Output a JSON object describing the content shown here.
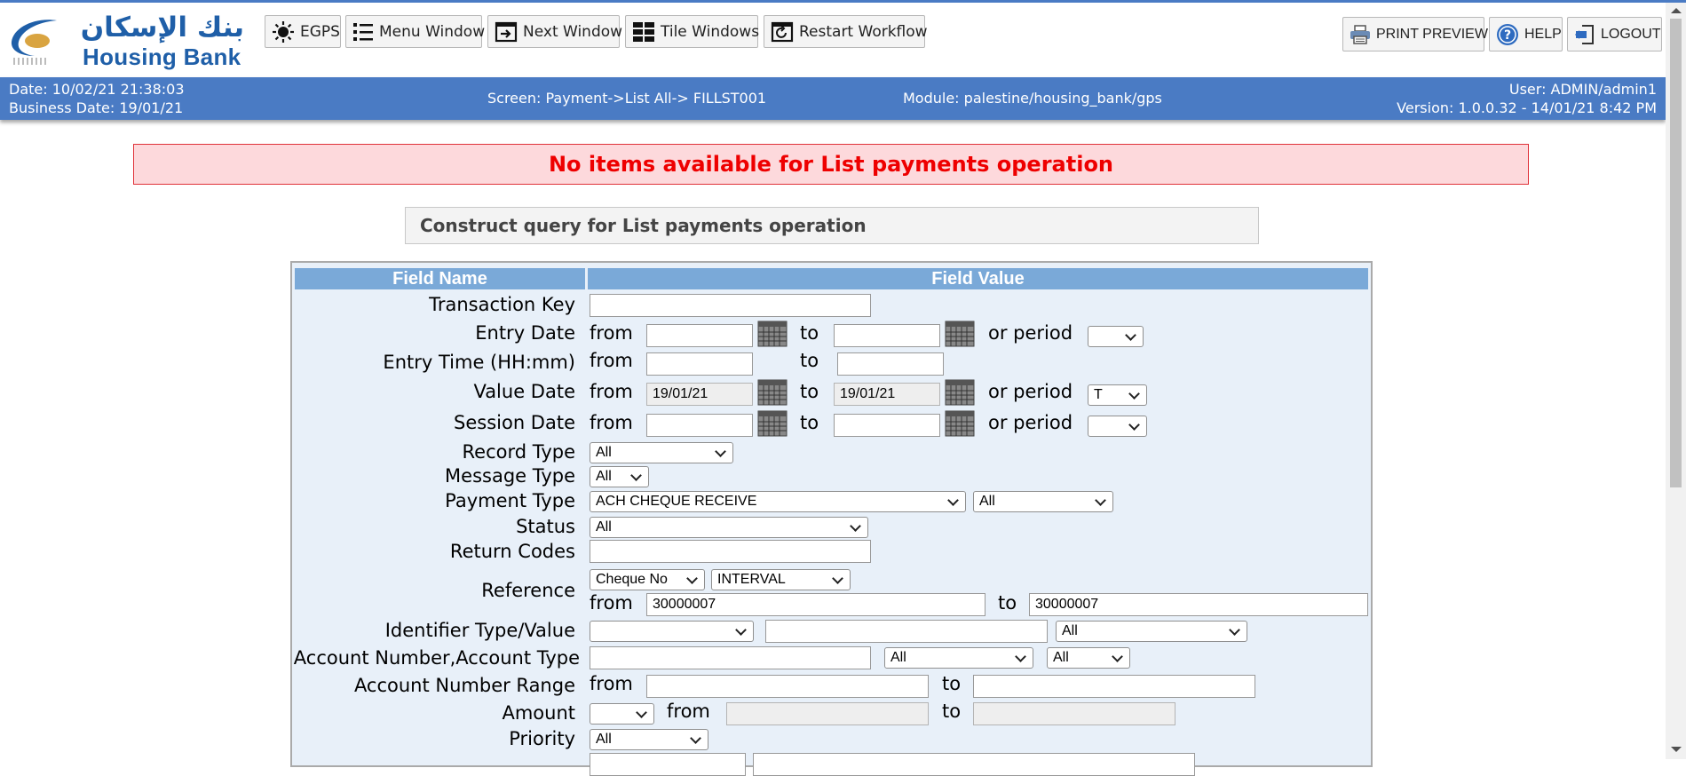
{
  "header": {
    "logo_ar": "بنك الإسكان",
    "logo_en": "Housing Bank",
    "buttons": {
      "egps": "EGPS",
      "menu_window": "Menu Window",
      "next_window": "Next Window",
      "tile_windows": "Tile Windows",
      "restart_workflow": "Restart Workflow",
      "print_preview": "PRINT PREVIEW",
      "help": "HELP",
      "logout": "LOGOUT"
    }
  },
  "info": {
    "date": "Date: 10/02/21 21:38:03",
    "business_date": "Business Date: 19/01/21",
    "screen": "Screen: Payment->List All-> FILLST001",
    "module": "Module: palestine/housing_bank/gps",
    "user": "User: ADMIN/admin1",
    "version": "Version: 1.0.0.32 - 14/01/21 8:42 PM"
  },
  "message": "No items available for List payments operation",
  "query_title": "Construct query for List payments operation",
  "table": {
    "col_field_name": "Field Name",
    "col_field_value": "Field Value"
  },
  "words": {
    "from": "from",
    "to": "to",
    "or_period": "or period"
  },
  "fields": {
    "transaction_key": {
      "label": "Transaction Key",
      "value": ""
    },
    "entry_date": {
      "label": "Entry Date",
      "from": "",
      "to": "",
      "period": ""
    },
    "entry_time": {
      "label": "Entry Time (HH:mm)",
      "from": "",
      "to": ""
    },
    "value_date": {
      "label": "Value Date",
      "from": "19/01/21",
      "to": "19/01/21",
      "period": "T"
    },
    "session_date": {
      "label": "Session Date",
      "from": "",
      "to": "",
      "period": ""
    },
    "record_type": {
      "label": "Record Type",
      "value": "All"
    },
    "message_type": {
      "label": "Message Type",
      "value": "All"
    },
    "payment_type": {
      "label": "Payment Type",
      "value": "ACH CHEQUE RECEIVE",
      "value2": "All"
    },
    "status": {
      "label": "Status",
      "value": "All"
    },
    "return_codes": {
      "label": "Return Codes",
      "value": ""
    },
    "reference": {
      "label": "Reference",
      "kind": "Cheque No",
      "mode": "INTERVAL",
      "from": "30000007",
      "to": "30000007"
    },
    "identifier": {
      "label": "Identifier Type/Value",
      "type": "",
      "value": "",
      "extra": "All"
    },
    "account": {
      "label": "Account Number,Account Type",
      "number": "",
      "type1": "All",
      "type2": "All"
    },
    "account_range": {
      "label": "Account Number Range",
      "from": "",
      "to": ""
    },
    "amount": {
      "label": "Amount",
      "op": "",
      "from": "",
      "to": ""
    },
    "priority": {
      "label": "Priority",
      "value": "All"
    }
  },
  "colors": {
    "brand_blue": "#4a7bc4",
    "header_blue": "#7aa9d8",
    "error_red": "#ee0000",
    "error_bg": "#fdd9dc",
    "form_bg": "#e8f0f9"
  },
  "icons": [
    "sun-icon",
    "list-icon",
    "next-window-icon",
    "tile-icon",
    "restart-icon",
    "printer-icon",
    "help-icon",
    "logout-icon",
    "calendar-icon",
    "chevron-down-icon"
  ]
}
